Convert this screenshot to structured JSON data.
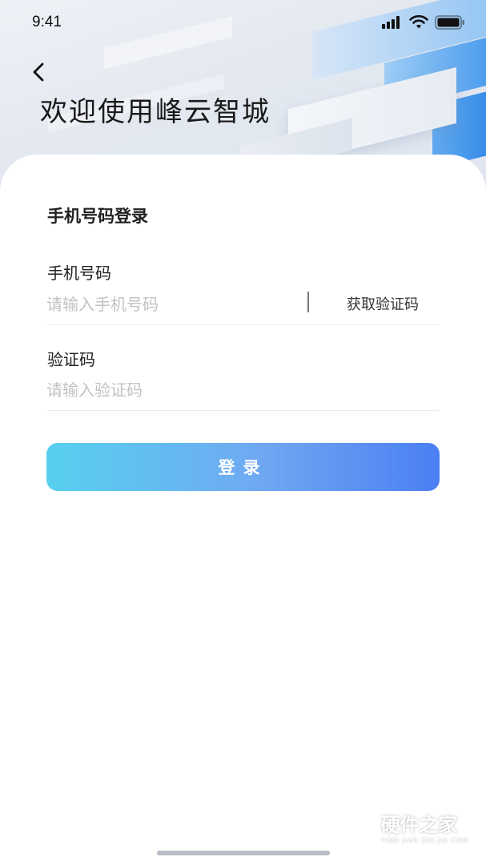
{
  "status_bar": {
    "time": "9:41",
    "icons": [
      "signal-icon",
      "wifi-icon",
      "battery-icon"
    ]
  },
  "header": {
    "back_icon": "chevron-left-icon",
    "title": "欢迎使用峰云智城"
  },
  "form": {
    "title": "手机号码登录",
    "phone": {
      "label": "手机号码",
      "placeholder": "请输入手机号码",
      "value": ""
    },
    "get_code_label": "获取验证码",
    "code": {
      "label": "验证码",
      "placeholder": "请输入验证码",
      "value": ""
    },
    "submit_label": "登录"
  },
  "watermark": {
    "cn": "硬件之家",
    "en": "YING JIAN ZHI JIA.COM"
  },
  "colors": {
    "accent_start": "#57d0ef",
    "accent_end": "#4b7ff3",
    "placeholder": "#c2c2c2"
  }
}
